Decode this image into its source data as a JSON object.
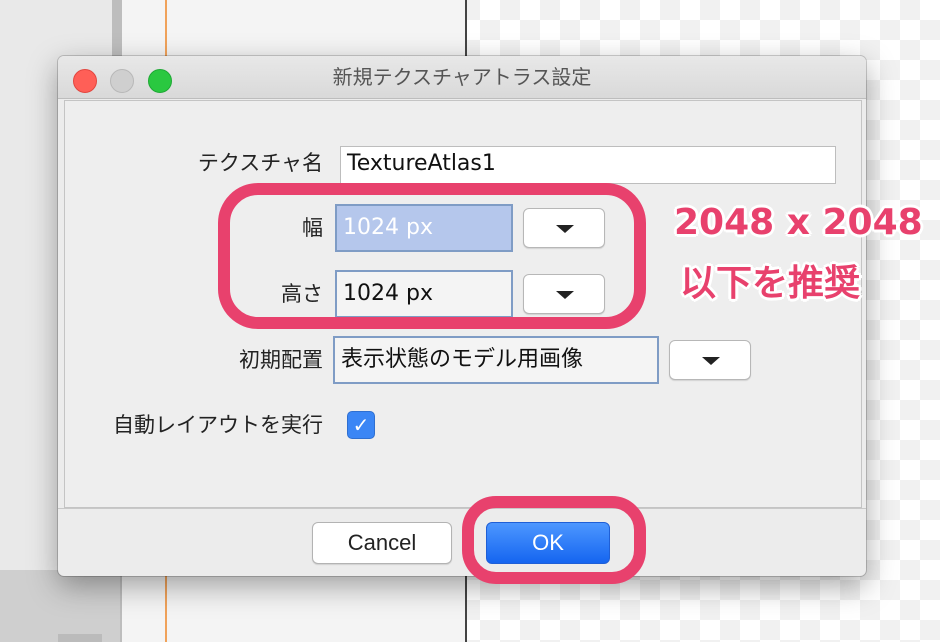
{
  "dialog": {
    "title": "新規テクスチャアトラス設定",
    "texture_name_label": "テクスチャ名",
    "texture_name_value": "TextureAtlas1",
    "width_label": "幅",
    "width_value": "1024 px",
    "height_label": "高さ",
    "height_value": "1024 px",
    "initial_layout_label": "初期配置",
    "initial_layout_value": "表示状態のモデル用画像",
    "auto_layout_label": "自動レイアウトを実行",
    "auto_layout_checked": true,
    "cancel_label": "Cancel",
    "ok_label": "OK"
  },
  "annotation": {
    "line1": "2048 x 2048",
    "line2": "以下を推奨",
    "color": "#e8416d"
  },
  "icons": {
    "dropdown": "chevron-down-icon",
    "checkmark": "✓"
  }
}
